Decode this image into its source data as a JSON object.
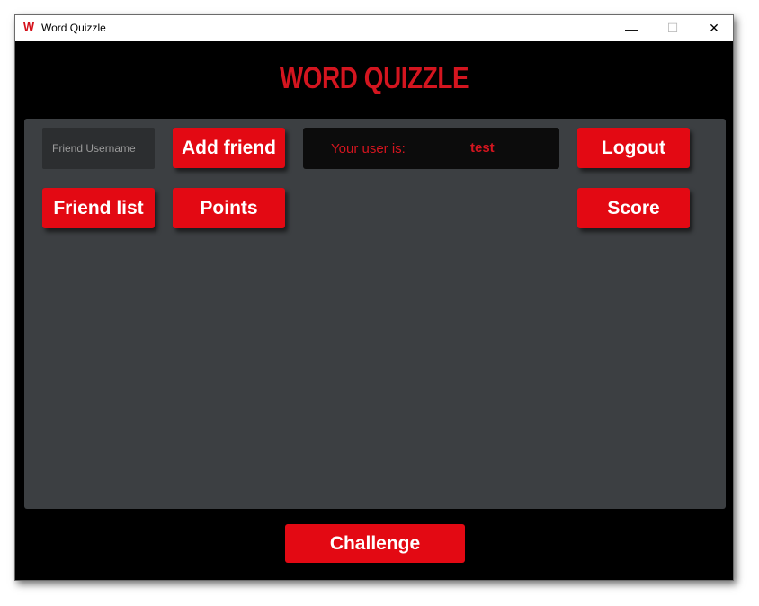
{
  "window": {
    "title": "Word Quizzle",
    "icon_letter": "W",
    "minimize": "—",
    "maximize": "☐",
    "close": "✕"
  },
  "logo": "WORD QUIZZLE",
  "friend_input": {
    "placeholder": "Friend Username",
    "value": ""
  },
  "buttons": {
    "add_friend": "Add friend",
    "logout": "Logout",
    "friend_list": "Friend list",
    "points": "Points",
    "score": "Score",
    "challenge": "Challenge"
  },
  "user_info": {
    "label": "Your user is:",
    "username": "test"
  },
  "colors": {
    "accent": "#e30913",
    "background": "#000000",
    "panel": "#3c3f42"
  }
}
